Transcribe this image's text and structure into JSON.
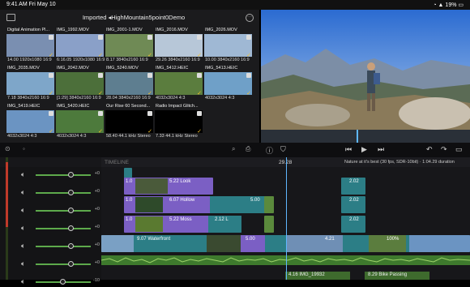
{
  "status": {
    "time": "9:41 AM",
    "date": "Fri May 10",
    "battery": "19%"
  },
  "browser": {
    "title": "Imported ◂HighMountain5point0Demo",
    "clips": [
      {
        "name": "Digital Animation Pl...",
        "meta": "14.00  1920x1080  16:9",
        "color": "#7a8fb1"
      },
      {
        "name": "IMG_1992.MOV",
        "meta": "6:16.05  1920x1080  16:9",
        "color": "#8aa0c8"
      },
      {
        "name": "IMG_2001-1.MOV",
        "meta": "8.17  3840x2160  16:9",
        "color": "#6f8a55"
      },
      {
        "name": "IMG_2016.MOV",
        "meta": "29.26  3840x2160  16:9",
        "color": "#b7c7d8"
      },
      {
        "name": "IMG_2026.MOV",
        "meta": "10.00  3840x2160  16:9",
        "color": "#9fb8d4"
      },
      {
        "name": "IMG_2035.MOV",
        "meta": "7.18  3840x2160  16:9",
        "color": "#7ea6c9"
      },
      {
        "name": "IMG_2042.MOV",
        "meta": "[1:29]  3840x2160  16:9",
        "color": "#4c6f3a"
      },
      {
        "name": "IMG_5240.MOV",
        "meta": "28.04  3840x2160  16:9",
        "color": "#5e7e90"
      },
      {
        "name": "IMG_5412.HEIC",
        "meta": "4032x3024  4:3",
        "color": "#5b7d3e"
      },
      {
        "name": "IMG_5413.HEIC",
        "meta": "4032x3024  4:3",
        "color": "#6fa0c8"
      },
      {
        "name": "IMG_5419.HEIC",
        "meta": "4032x3024  4:3",
        "color": "#6b94c2"
      },
      {
        "name": "IMG_5420.HEIC",
        "meta": "4032x3024  4:3",
        "color": "#4d7a3c"
      },
      {
        "name": "Our Rise 60 Second...",
        "meta": "58.40  44.1 kHz  Stereo",
        "color": "#000"
      },
      {
        "name": "Radio Impact Glitch...",
        "meta": "7.33  44.1 kHz  Stereo",
        "color": "#000"
      }
    ]
  },
  "timeline": {
    "label": "TIMELINE",
    "timecode": "29.28",
    "info": "Nature at it's best (30 fps, SDR-10bit) · 1:04.29 duration",
    "db_values": [
      "+0",
      "+0",
      "+0",
      "+0",
      "+0",
      "+0",
      "-10"
    ],
    "clips": {
      "look": "5.22  Look",
      "hollow": "6.07  Hollow",
      "hollow_dur": "5.00",
      "moss": "5.22  Moss",
      "moss_dur": "2.12  L",
      "waterfront": "9.07  Waterfront",
      "waterfront_dur": "5.00",
      "c1": "1.0",
      "c2": "4.21",
      "pct": "100%",
      "audio1": "4.16  IMG_19932",
      "audio2": "8.29  Bike Passing"
    },
    "numbers": [
      "2.02",
      "2.02",
      "2.02"
    ]
  },
  "colors": {
    "accent": "#f5c12b",
    "playhead": "#5fb7ff",
    "purple": "#7b5fc4",
    "teal": "#2c7e86"
  }
}
